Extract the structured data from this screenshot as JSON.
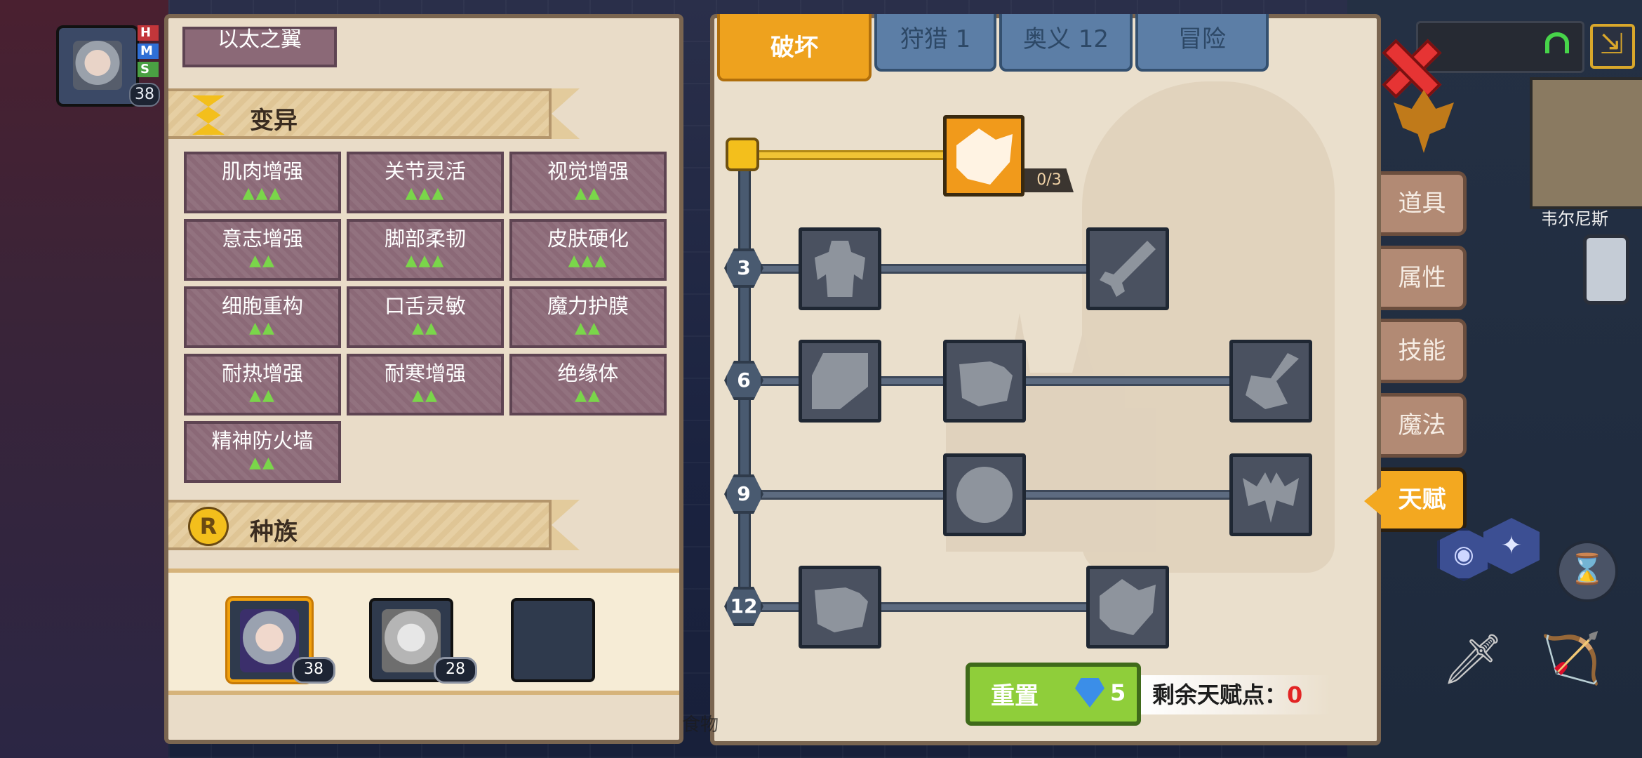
{
  "player": {
    "level": "38",
    "bars": [
      "H",
      "M",
      "S"
    ]
  },
  "left_panel": {
    "previous_item": "以太之翼",
    "mutation_section": {
      "title": "变异",
      "items": [
        {
          "name": "肌肉增强",
          "level": "▲▲▲"
        },
        {
          "name": "关节灵活",
          "level": "▲▲▲"
        },
        {
          "name": "视觉增强",
          "level": "▲▲"
        },
        {
          "name": "意志增强",
          "level": "▲▲"
        },
        {
          "name": "脚部柔韧",
          "level": "▲▲▲"
        },
        {
          "name": "皮肤硬化",
          "level": "▲▲▲"
        },
        {
          "name": "细胞重构",
          "level": "▲▲"
        },
        {
          "name": "口舌灵敏",
          "level": "▲▲"
        },
        {
          "name": "魔力护膜",
          "level": "▲▲"
        },
        {
          "name": "耐热增强",
          "level": "▲▲"
        },
        {
          "name": "耐寒增强",
          "level": "▲▲"
        },
        {
          "name": "绝缘体",
          "level": "▲▲"
        },
        {
          "name": "精神防火墙",
          "level": "▲▲"
        }
      ]
    },
    "race_section": {
      "title": "种族",
      "icon_letter": "R"
    },
    "characters": [
      {
        "level": "38",
        "selected": true
      },
      {
        "level": "28",
        "selected": false
      },
      {
        "level": "",
        "selected": false
      }
    ]
  },
  "talent_panel": {
    "tabs": [
      "破坏",
      "狩猎 1",
      "奥义 12",
      "冒险"
    ],
    "active_tab": "破坏",
    "row_levels": [
      "3",
      "6",
      "9",
      "12"
    ],
    "top_skill_progress": "0/3",
    "skills": [
      {
        "name": "arm-wrestle-icon",
        "active": true
      },
      {
        "name": "body-strength-icon"
      },
      {
        "name": "arrow-deflect-icon"
      },
      {
        "name": "card-strike-icon"
      },
      {
        "name": "fist-punch-icon"
      },
      {
        "name": "splash-attack-icon"
      },
      {
        "name": "ripple-ring-icon"
      },
      {
        "name": "bat-wings-icon"
      },
      {
        "name": "raised-fist-icon"
      },
      {
        "name": "hand-grip-icon"
      }
    ],
    "reset_label": "重置",
    "reset_cost": "5",
    "remaining_label": "剩余天赋点：",
    "remaining_value": "0"
  },
  "side_tabs": [
    "道具",
    "属性",
    "技能",
    "魔法",
    "天赋"
  ],
  "active_side_tab": "天赋",
  "map_label": "韦尔尼斯",
  "background_text": "食物",
  "colors": {
    "accent_orange": "#eea21e",
    "mutation_cell": "#8b6977",
    "reset_green": "#8fce3a",
    "points_red": "#e22424"
  }
}
